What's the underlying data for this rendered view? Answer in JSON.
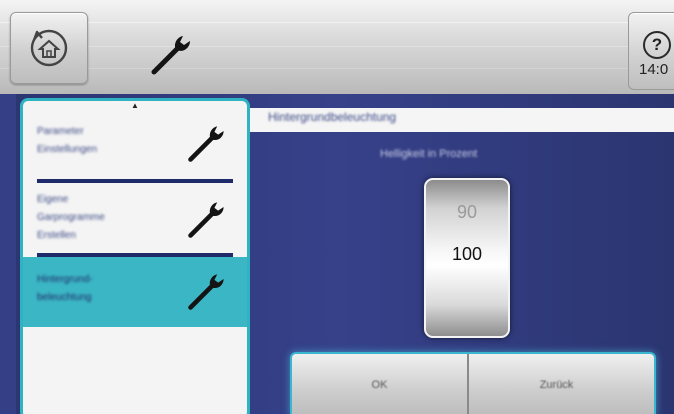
{
  "toolbar": {
    "home_icon": "home-back-icon",
    "header_icon": "wrench-icon",
    "help_symbol": "?",
    "time": "14:0"
  },
  "menu": {
    "scroll_indicator": "▲",
    "items": [
      {
        "label": "Parameter\nEinstellungen",
        "icon": "wrench-icon",
        "active": false
      },
      {
        "label": "Eigene\nGarprogramme\nErstellen",
        "icon": "wrench-icon",
        "active": false
      },
      {
        "label": "Hintergrund-\nbeleuchtung",
        "icon": "wrench-icon",
        "active": true
      }
    ]
  },
  "content": {
    "title": "Hintergrundbeleuchtung",
    "subtitle": "Helligkeit in Prozent",
    "picker": {
      "previous_value": "90",
      "current_value": "100"
    },
    "buttons": {
      "ok": "OK",
      "back": "Zurück"
    }
  },
  "colors": {
    "background": "#36418a",
    "accent": "#3bb6c4",
    "menu_label": "#3d4a86"
  }
}
